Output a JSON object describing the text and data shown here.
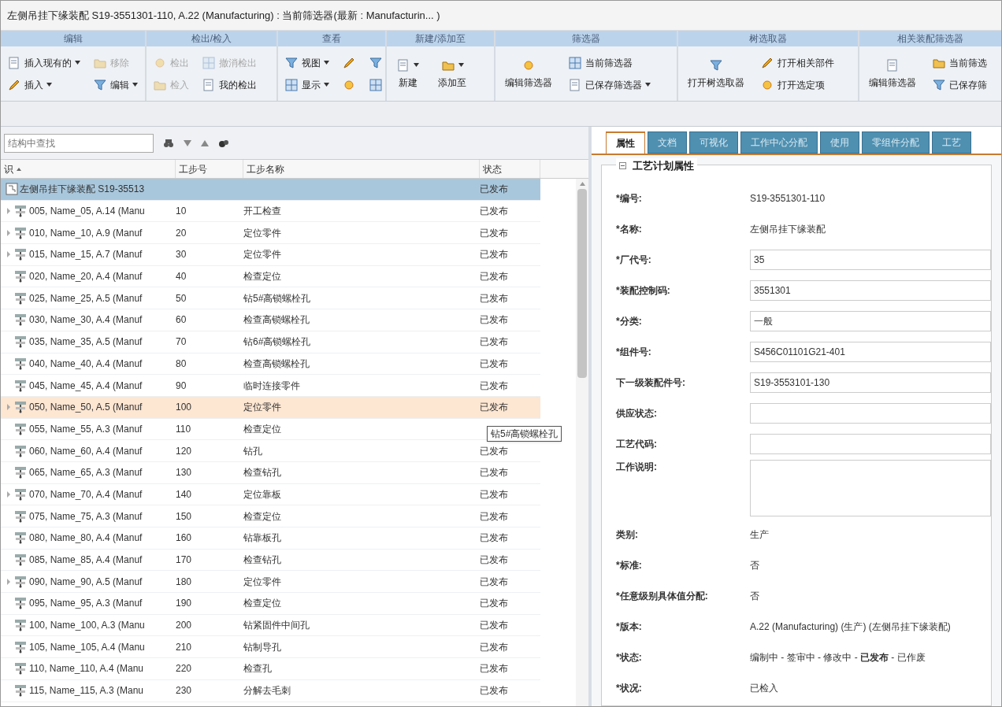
{
  "window": {
    "title": "左侧吊挂下缘装配 S19-3551301-110, A.22 (Manufacturing) : 当前筛选器(最新 : Manufacturin... )"
  },
  "ribbon": [
    {
      "title": "编辑",
      "columns": [
        [
          {
            "label": "插入现有的",
            "dropdown": true,
            "disabled": false
          },
          {
            "label": "插入",
            "dropdown": true,
            "disabled": false
          }
        ],
        [
          {
            "label": "移除",
            "dropdown": false,
            "disabled": true
          },
          {
            "label": "编辑",
            "dropdown": true,
            "disabled": false
          }
        ]
      ]
    },
    {
      "title": "检出/检入",
      "columns": [
        [
          {
            "label": "检出",
            "dropdown": false,
            "disabled": true
          },
          {
            "label": "检入",
            "dropdown": false,
            "disabled": true
          }
        ],
        [
          {
            "label": "撤消检出",
            "dropdown": false,
            "disabled": true
          },
          {
            "label": "我的检出",
            "dropdown": false,
            "disabled": false
          }
        ]
      ]
    },
    {
      "title": "查看",
      "columns": [
        [
          {
            "label": "视图",
            "dropdown": true,
            "disabled": false
          },
          {
            "label": "显示",
            "dropdown": true,
            "disabled": false
          }
        ],
        [
          {
            "dropdown": false,
            "disabled": false
          },
          {
            "dropdown": false,
            "disabled": false
          }
        ],
        [
          {
            "dropdown": false,
            "disabled": false
          },
          {
            "dropdown": false,
            "disabled": false
          }
        ]
      ]
    },
    {
      "title": "新建/添加至",
      "columns": [
        [
          {
            "label": "新建",
            "kind": "large",
            "dropdown": true,
            "disabled": false
          }
        ],
        [
          {
            "label": "添加至",
            "kind": "large",
            "dropdown": true,
            "disabled": false
          }
        ]
      ]
    },
    {
      "title": "筛选器",
      "columns": [
        [
          {
            "label": "编辑筛选器",
            "kind": "large",
            "dropdown": false,
            "disabled": false
          }
        ],
        [
          {
            "label": "当前筛选器",
            "dropdown": false,
            "disabled": false
          },
          {
            "label": "已保存筛选器",
            "dropdown": true,
            "disabled": false
          }
        ]
      ]
    },
    {
      "title": "树选取器",
      "columns": [
        [
          {
            "label": "打开树选取器",
            "kind": "large",
            "dropdown": false,
            "disabled": false
          }
        ],
        [
          {
            "label": "打开相关部件",
            "dropdown": false,
            "disabled": false
          },
          {
            "label": "打开选定项",
            "dropdown": false,
            "disabled": false
          }
        ]
      ]
    },
    {
      "title": "相关装配筛选器",
      "columns": [
        [
          {
            "label": "编辑筛选器",
            "kind": "large",
            "dropdown": false,
            "disabled": false
          }
        ],
        [
          {
            "label": "当前筛选",
            "dropdown": false,
            "disabled": false
          },
          {
            "label": "已保存筛",
            "dropdown": false,
            "disabled": false
          }
        ]
      ]
    }
  ],
  "tree": {
    "search": {
      "placeholder": "结构中查找"
    },
    "columns": [
      "识",
      "工步号",
      "工步名称",
      "状态"
    ],
    "root": {
      "label": "左侧吊挂下缘装配 S19-35513",
      "status": "已发布",
      "selected": true,
      "children": [
        {
          "label": "005, Name_05, A.14 (Manu",
          "step": "10",
          "name": "开工检查",
          "status": "已发布",
          "expandable": true,
          "selected": false,
          "hovered": false
        },
        {
          "label": "010, Name_10, A.9 (Manuf",
          "step": "20",
          "name": "定位零件",
          "status": "已发布",
          "expandable": true,
          "selected": false,
          "hovered": false
        },
        {
          "label": "015, Name_15, A.7 (Manuf",
          "step": "30",
          "name": "定位零件",
          "status": "已发布",
          "expandable": true,
          "selected": false,
          "hovered": false
        },
        {
          "label": "020, Name_20, A.4 (Manuf",
          "step": "40",
          "name": "检查定位",
          "status": "已发布",
          "expandable": false,
          "selected": false,
          "hovered": false
        },
        {
          "label": "025, Name_25, A.5 (Manuf",
          "step": "50",
          "name": "钻5#高锁螺栓孔",
          "status": "已发布",
          "expandable": false,
          "selected": false,
          "hovered": false
        },
        {
          "label": "030, Name_30, A.4 (Manuf",
          "step": "60",
          "name": "检查高锁螺栓孔",
          "status": "已发布",
          "expandable": false,
          "selected": false,
          "hovered": false
        },
        {
          "label": "035, Name_35, A.5 (Manuf",
          "step": "70",
          "name": "钻6#高锁螺栓孔",
          "status": "已发布",
          "expandable": false,
          "selected": false,
          "hovered": false
        },
        {
          "label": "040, Name_40, A.4 (Manuf",
          "step": "80",
          "name": "检查高锁螺栓孔",
          "status": "已发布",
          "expandable": false,
          "selected": false,
          "hovered": false
        },
        {
          "label": "045, Name_45, A.4 (Manuf",
          "step": "90",
          "name": "临时连接零件",
          "status": "已发布",
          "expandable": false,
          "selected": false,
          "hovered": false
        },
        {
          "label": "050, Name_50, A.5 (Manuf",
          "step": "100",
          "name": "定位零件",
          "status": "已发布",
          "expandable": true,
          "selected": false,
          "hovered": true
        },
        {
          "label": "055, Name_55, A.3 (Manuf",
          "step": "110",
          "name": "检查定位",
          "expandable": false,
          "selected": false,
          "hovered": false
        },
        {
          "label": "060, Name_60, A.4 (Manuf",
          "step": "120",
          "name": "钻孔",
          "status": "已发布",
          "expandable": false,
          "selected": false,
          "hovered": false
        },
        {
          "label": "065, Name_65, A.3 (Manuf",
          "step": "130",
          "name": "检查钻孔",
          "status": "已发布",
          "expandable": false,
          "selected": false,
          "hovered": false
        },
        {
          "label": "070, Name_70, A.4 (Manuf",
          "step": "140",
          "name": "定位靠板",
          "status": "已发布",
          "expandable": true,
          "selected": false,
          "hovered": false
        },
        {
          "label": "075, Name_75, A.3 (Manuf",
          "step": "150",
          "name": "检查定位",
          "status": "已发布",
          "expandable": false,
          "selected": false,
          "hovered": false
        },
        {
          "label": "080, Name_80, A.4 (Manuf",
          "step": "160",
          "name": "钻靠板孔",
          "status": "已发布",
          "expandable": false,
          "selected": false,
          "hovered": false
        },
        {
          "label": "085, Name_85, A.4 (Manuf",
          "step": "170",
          "name": "检查钻孔",
          "status": "已发布",
          "expandable": false,
          "selected": false,
          "hovered": false
        },
        {
          "label": "090, Name_90, A.5 (Manuf",
          "step": "180",
          "name": "定位零件",
          "status": "已发布",
          "expandable": true,
          "selected": false,
          "hovered": false
        },
        {
          "label": "095, Name_95, A.3 (Manuf",
          "step": "190",
          "name": "检查定位",
          "status": "已发布",
          "expandable": false,
          "selected": false,
          "hovered": false
        },
        {
          "label": "100, Name_100, A.3 (Manu",
          "step": "200",
          "name": "钻紧固件中间孔",
          "status": "已发布",
          "expandable": false,
          "selected": false,
          "hovered": false
        },
        {
          "label": "105, Name_105, A.4 (Manu",
          "step": "210",
          "name": "钻制导孔",
          "status": "已发布",
          "expandable": false,
          "selected": false,
          "hovered": false
        },
        {
          "label": "110, Name_110, A.4 (Manu",
          "step": "220",
          "name": "检查孔",
          "status": "已发布",
          "expandable": false,
          "selected": false,
          "hovered": false
        },
        {
          "label": "115, Name_115, A.3 (Manu",
          "step": "230",
          "name": "分解去毛刺",
          "status": "已发布",
          "expandable": false,
          "selected": false,
          "hovered": false
        }
      ]
    },
    "tooltip": "钻5#高锁螺栓孔"
  },
  "details": {
    "tabs": [
      {
        "label": "属性",
        "selected": true
      },
      {
        "label": "文档",
        "selected": false
      },
      {
        "label": "可视化",
        "selected": false
      },
      {
        "label": "工作中心分配",
        "selected": false
      },
      {
        "label": "使用",
        "selected": false
      },
      {
        "label": "零组件分配",
        "selected": false
      },
      {
        "label": "工艺",
        "selected": false
      }
    ],
    "section": {
      "title": "工艺计划属性",
      "expanded": true
    },
    "fields": [
      {
        "label": "*编号:",
        "kind": "text",
        "value": "S19-3551301-110"
      },
      {
        "label": "*名称:",
        "kind": "text",
        "value": "左侧吊挂下缘装配"
      },
      {
        "label": "*厂代号:",
        "kind": "input",
        "value": "35"
      },
      {
        "label": "*装配控制码:",
        "kind": "input",
        "value": "3551301"
      },
      {
        "label": "*分类:",
        "kind": "input",
        "value": "一般"
      },
      {
        "label": "*组件号:",
        "kind": "input",
        "value": "S456C01101G21-401"
      },
      {
        "label": "下一级装配件号:",
        "kind": "input",
        "value": "S19-3553101-130"
      },
      {
        "label": "供应状态:",
        "kind": "input"
      },
      {
        "label": "工艺代码:",
        "kind": "input"
      },
      {
        "label": "工作说明:",
        "kind": "textarea"
      },
      {
        "label": "类别:",
        "kind": "text",
        "value": "生产"
      },
      {
        "label": "*标准:",
        "kind": "text",
        "value": "否"
      },
      {
        "label": "*任意级别具体值分配:",
        "kind": "text",
        "value": "否"
      },
      {
        "label": "*版本:",
        "kind": "text",
        "value": "A.22 (Manufacturing) (生产) (左侧吊挂下缘装配)"
      },
      {
        "label": "*状态:",
        "kind": "text",
        "value": "编制中 - 签审中 - 修改中 - **已发布** - 已作废"
      },
      {
        "label": "*状况:",
        "kind": "text",
        "value": "已检入"
      }
    ]
  }
}
